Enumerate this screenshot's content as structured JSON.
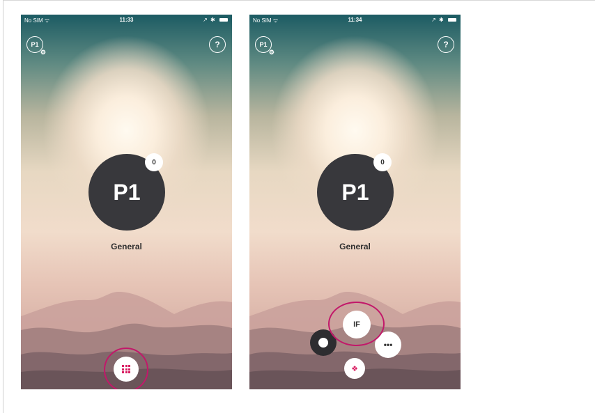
{
  "phones": [
    {
      "status": {
        "carrier": "No SIM",
        "time": "11:33",
        "icons": "↗ ✱"
      },
      "profile_label": "P1",
      "help_label": "?",
      "program": {
        "label": "P1",
        "count": "0",
        "name": "General"
      }
    },
    {
      "status": {
        "carrier": "No SIM",
        "time": "11:34",
        "icons": "↗ ✱"
      },
      "profile_label": "P1",
      "help_label": "?",
      "program": {
        "label": "P1",
        "count": "0",
        "name": "General"
      },
      "action_menu": {
        "if_label": "IF",
        "more_label": "•••",
        "diamond_glyph": "❖"
      }
    }
  ],
  "colors": {
    "highlight_ring": "#c2186a",
    "accent": "#d81b60",
    "program_circle": "#38383c"
  },
  "icons": {
    "menu": "grid-icon",
    "settings_badge": "gear-icon",
    "wifi": "wifi-icon"
  }
}
